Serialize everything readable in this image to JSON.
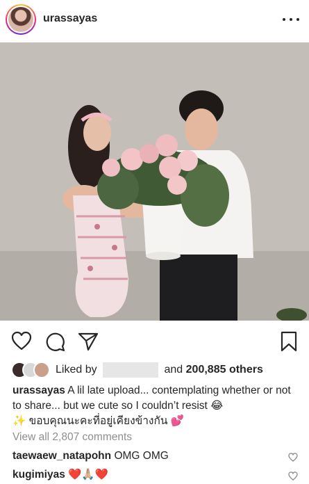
{
  "post": {
    "username": "urassayas"
  },
  "likes": {
    "prefix": "Liked by",
    "connector": "and",
    "others": "200,885 others"
  },
  "caption": {
    "username": "urassayas",
    "text": "A lil late upload... contemplating whether or not to share... but we cute so I couldn’t resist 😂",
    "line2": "✨ ขอบคุณนะคะที่อยู่เคียงข้างกัน 💕"
  },
  "comments": {
    "view_all": "View all 2,807 comments",
    "items": [
      {
        "username": "taewaew_natapohn",
        "text": "OMG OMG"
      },
      {
        "username": "kugimiyas",
        "text": "❤️🙏🏼❤️"
      }
    ]
  },
  "icons": {
    "more": "more-options-icon",
    "like": "heart-icon",
    "comment": "comment-icon",
    "share": "share-icon",
    "save": "bookmark-icon"
  },
  "colors": {
    "story_ring": "#ee2a7b",
    "text": "#262626",
    "muted": "#8e8e8e"
  }
}
